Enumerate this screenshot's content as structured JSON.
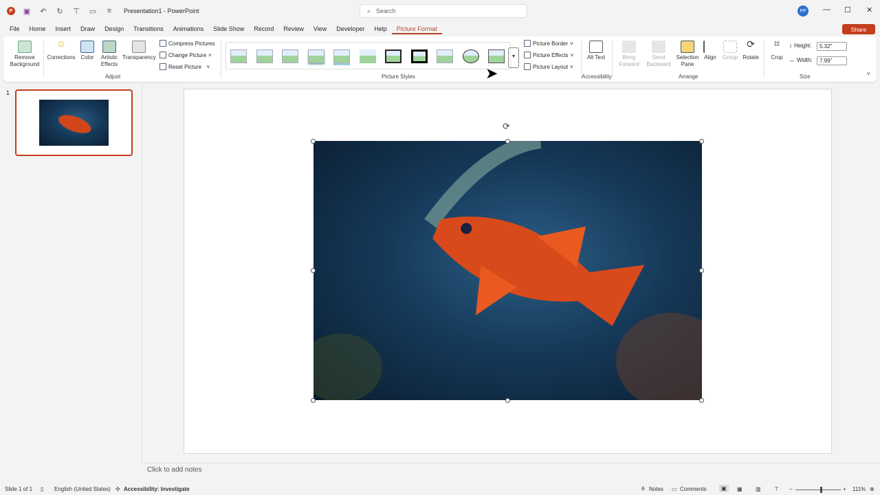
{
  "titlebar": {
    "title": "Presentation1  -  PowerPoint",
    "search_placeholder": "Search",
    "avatar": "PP"
  },
  "menu": [
    "File",
    "Home",
    "Insert",
    "Draw",
    "Design",
    "Transitions",
    "Animations",
    "Slide Show",
    "Record",
    "Review",
    "View",
    "Developer",
    "Help",
    "Picture Format"
  ],
  "share": "Share",
  "ribbon": {
    "adjust": {
      "remove_bg": "Remove Background",
      "corrections": "Corrections",
      "color": "Color",
      "artistic": "Artistic Effects",
      "transparency": "Transparency",
      "compress": "Compress Pictures",
      "change": "Change Picture",
      "reset": "Reset Picture",
      "label": "Adjust"
    },
    "styles": {
      "label": "Picture Styles",
      "border": "Picture Border",
      "effects": "Picture Effects",
      "layout": "Picture Layout"
    },
    "accessibility": {
      "alt_text": "Alt Text",
      "label": "Accessibility"
    },
    "arrange": {
      "bring_forward": "Bring Forward",
      "send_backward": "Send Backward",
      "selection_pane": "Selection Pane",
      "align": "Align",
      "group": "Group",
      "rotate": "Rotate",
      "label": "Arrange"
    },
    "size": {
      "crop": "Crop",
      "height_label": "Height:",
      "height": "5.32\"",
      "width_label": "Width:",
      "width": "7.99\"",
      "label": "Size"
    }
  },
  "thumbnails": [
    {
      "number": "1"
    }
  ],
  "notes_placeholder": "Click to add notes",
  "status": {
    "slide": "Slide 1 of 1",
    "language": "English (United States)",
    "accessibility": "Accessibility: Investigate",
    "notes": "Notes",
    "comments": "Comments",
    "zoom": "111%"
  },
  "zoom_level": 0.55
}
